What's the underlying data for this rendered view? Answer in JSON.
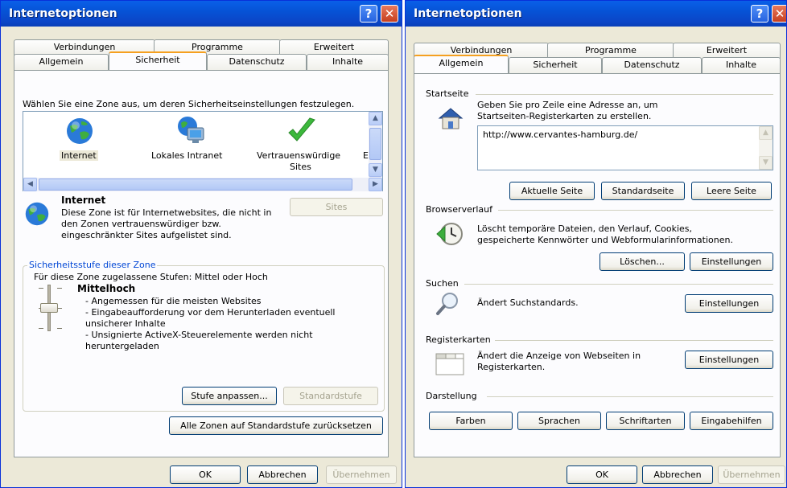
{
  "left_window": {
    "title": "Internetoptionen",
    "tabs_back": [
      "Verbindungen",
      "Programme",
      "Erweitert"
    ],
    "tabs_front": [
      "Allgemein",
      "Sicherheit",
      "Datenschutz",
      "Inhalte"
    ],
    "active_tab": "Sicherheit",
    "intro": "Wählen Sie eine Zone aus, um deren Sicherheitseinstellungen festzulegen.",
    "zones": [
      {
        "label": "Internet",
        "icon": "globe-icon"
      },
      {
        "label": "Lokales Intranet",
        "icon": "monitor-globe-icon"
      },
      {
        "label": "Vertrauenswürdige",
        "label2": "Sites",
        "icon": "checkmark-icon"
      },
      {
        "label": "E",
        "icon": "restricted-icon"
      }
    ],
    "zone_info": {
      "title": "Internet",
      "desc": [
        "Diese Zone ist für Internetwebsites, die nicht in",
        "den Zonen vertrauenswürdiger bzw.",
        "eingeschränkter Sites aufgelistet sind."
      ],
      "sites_button": "Sites"
    },
    "security_level": {
      "group_title": "Sicherheitsstufe dieser Zone",
      "allowed": "Für diese Zone zugelassene Stufen: Mittel oder Hoch",
      "level_name": "Mittelhoch",
      "bullets": [
        "- Angemessen für die meisten Websites",
        "- Eingabeaufforderung vor dem Herunterladen eventuell",
        "unsicherer Inhalte",
        "- Unsignierte ActiveX-Steuerelemente werden nicht",
        "heruntergeladen"
      ],
      "slider_level": 0.5,
      "custom_button": "Stufe anpassen...",
      "default_button": "Standardstufe"
    },
    "reset_all_button": "Alle Zonen auf Standardstufe zurücksetzen",
    "ok_button": "OK",
    "cancel_button": "Abbrechen",
    "apply_button": "Übernehmen"
  },
  "right_window": {
    "title": "Internetoptionen",
    "tabs_back": [
      "Verbindungen",
      "Programme",
      "Erweitert"
    ],
    "tabs_front": [
      "Allgemein",
      "Sicherheit",
      "Datenschutz",
      "Inhalte"
    ],
    "active_tab": "Allgemein",
    "startseite": {
      "group_title": "Startseite",
      "desc": [
        "Geben Sie pro Zeile eine Adresse an, um",
        "Startseiten-Registerkarten zu erstellen."
      ],
      "url": "http://www.cervantes-hamburg.de/",
      "current_button": "Aktuelle Seite",
      "default_button": "Standardseite",
      "blank_button": "Leere Seite"
    },
    "browserverlauf": {
      "group_title": "Browserverlauf",
      "desc": [
        "Löscht temporäre Dateien, den Verlauf, Cookies,",
        "gespeicherte Kennwörter und Webformularinformationen."
      ],
      "delete_button": "Löschen...",
      "settings_button": "Einstellungen"
    },
    "suchen": {
      "group_title": "Suchen",
      "desc": "Ändert Suchstandards.",
      "settings_button": "Einstellungen"
    },
    "registerkarten": {
      "group_title": "Registerkarten",
      "desc": [
        "Ändert die Anzeige von Webseiten in",
        "Registerkarten."
      ],
      "settings_button": "Einstellungen"
    },
    "darstellung": {
      "group_title": "Darstellung",
      "buttons": [
        "Farben",
        "Sprachen",
        "Schriftarten",
        "Eingabehilfen"
      ]
    },
    "ok_button": "OK",
    "cancel_button": "Abbrechen",
    "apply_button": "Übernehmen"
  },
  "colors": {
    "title_bar": "#0a5fe8",
    "window_bg": "#ece9d8",
    "active_tab_accent": "#f5a020",
    "group_title": "#0046d5"
  }
}
